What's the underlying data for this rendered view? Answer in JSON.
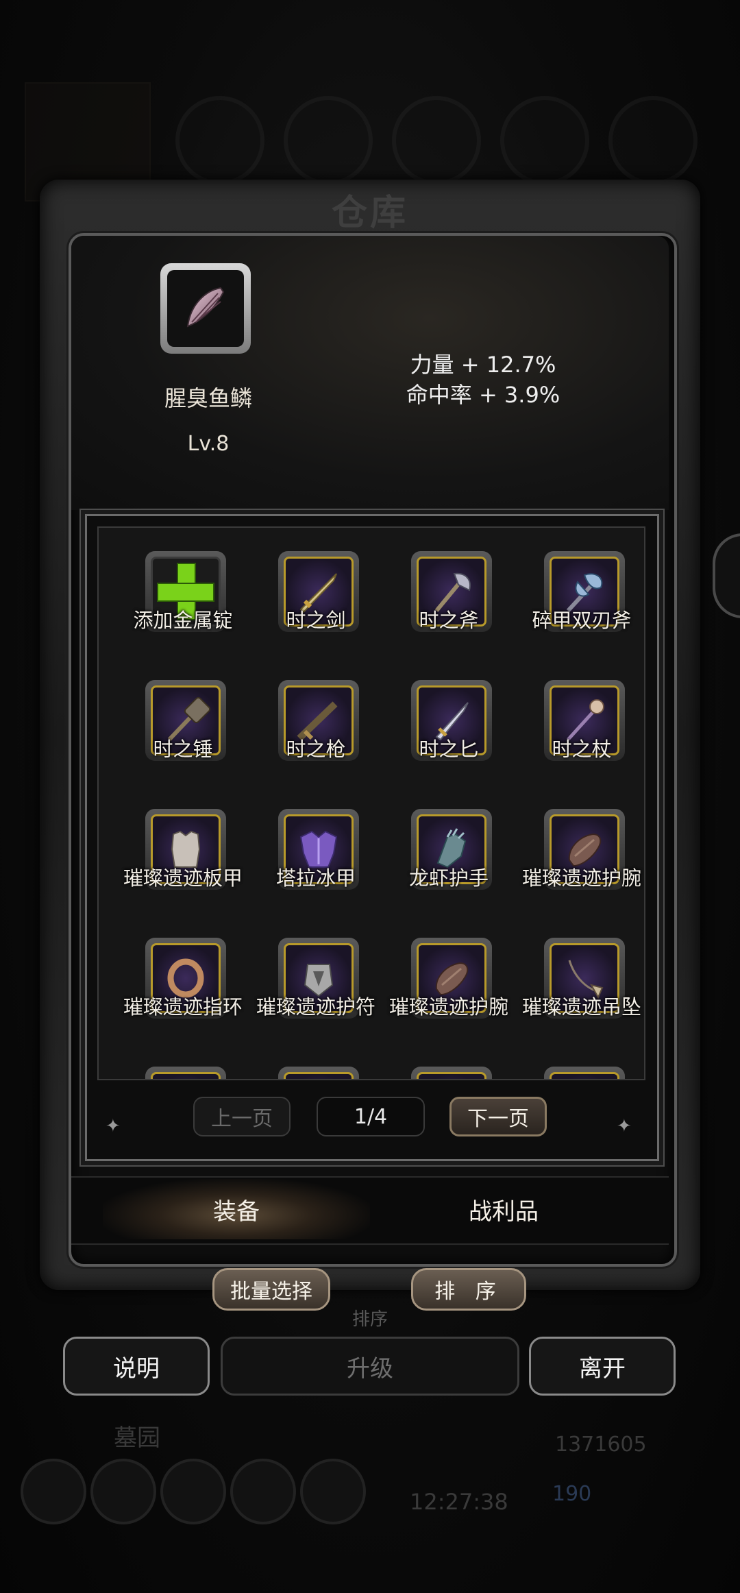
{
  "window": {
    "title": "仓库"
  },
  "selected_item": {
    "name": "腥臭鱼鳞",
    "level": "Lv.8",
    "icon": "fish-scale-icon",
    "stats": [
      "力量 + 12.7%",
      "命中率 + 3.9%"
    ]
  },
  "items": [
    {
      "label": "添加金属锭",
      "icon": "plus-icon"
    },
    {
      "label": "时之剑",
      "icon": "sword-icon"
    },
    {
      "label": "时之斧",
      "icon": "axe-icon"
    },
    {
      "label": "碎甲双刃斧",
      "icon": "double-axe-icon"
    },
    {
      "label": "时之锤",
      "icon": "hammer-icon"
    },
    {
      "label": "时之枪",
      "icon": "gun-icon"
    },
    {
      "label": "时之匕",
      "icon": "dagger-icon"
    },
    {
      "label": "时之杖",
      "icon": "staff-icon"
    },
    {
      "label": "璀璨遗迹板甲",
      "icon": "plate-armor-icon"
    },
    {
      "label": "塔拉冰甲",
      "icon": "ice-armor-icon"
    },
    {
      "label": "龙虾护手",
      "icon": "gauntlet-icon"
    },
    {
      "label": "璀璨遗迹护腕",
      "icon": "bracer-icon"
    },
    {
      "label": "璀璨遗迹指环",
      "icon": "ring-icon"
    },
    {
      "label": "璀璨遗迹护符",
      "icon": "amulet-icon"
    },
    {
      "label": "璀璨遗迹护腕",
      "icon": "bracer-icon"
    },
    {
      "label": "璀璨遗迹吊坠",
      "icon": "pendant-icon"
    }
  ],
  "pagination": {
    "prev": "上一页",
    "page": "1/4",
    "next": "下一页"
  },
  "tabs": {
    "equipment": "装备",
    "loot": "战利品"
  },
  "actions": {
    "batch_select": "批量选择",
    "sort": "排 序",
    "sort_ghost": "排序"
  },
  "buttons": {
    "help": "说明",
    "upgrade": "升级",
    "leave": "离开"
  },
  "background": {
    "guild": "墓园",
    "gold": "1371605",
    "gems": "190",
    "time": "12:27:38"
  }
}
